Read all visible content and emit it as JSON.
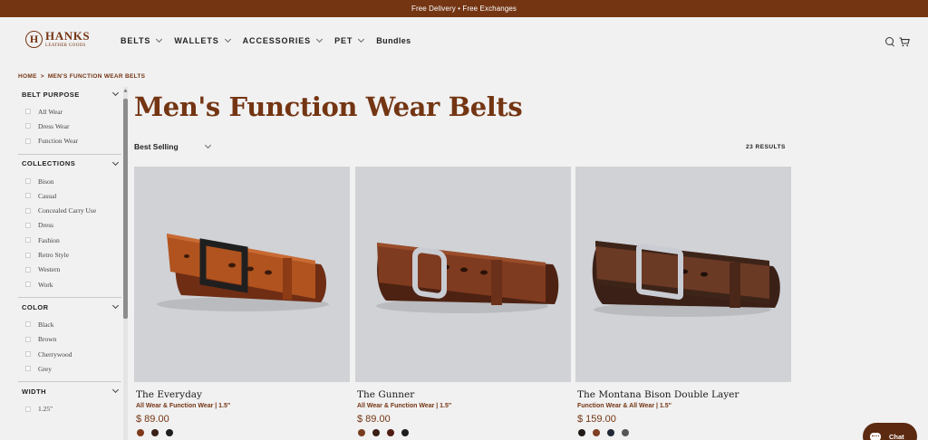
{
  "announcement": "Free Delivery • Free Exchanges",
  "brand": {
    "mark": "H",
    "name": "HANKS",
    "sub": "LEATHER GOODS",
    "color": "#743513"
  },
  "nav": [
    "BELTS",
    "WALLETS",
    "ACCESSORIES",
    "PET",
    "Bundles"
  ],
  "header_icons": [
    "search-icon",
    "cart-icon"
  ],
  "breadcrumb": {
    "home": "HOME",
    "separator": ">",
    "current": "MEN'S FUNCTION WEAR BELTS"
  },
  "filters": [
    {
      "title": "BELT PURPOSE",
      "options": [
        "All Wear",
        "Dress Wear",
        "Function Wear"
      ]
    },
    {
      "title": "COLLECTIONS",
      "options": [
        "Bison",
        "Casual",
        "Concealed Carry Use",
        "Dress",
        "Fashion",
        "Retro Style",
        "Western",
        "Work"
      ]
    },
    {
      "title": "COLOR",
      "options": [
        "Black",
        "Brown",
        "Cherrywood",
        "Grey"
      ]
    },
    {
      "title": "WIDTH",
      "options": [
        "1.25\""
      ]
    }
  ],
  "page_title": "Men's Function Wear Belts",
  "sort_label": "Best Selling",
  "results": "23 RESULTS",
  "products": [
    {
      "name": "The Everyday",
      "subtitle": "All Wear & Function Wear | 1.5\"",
      "price": "$ 89.00",
      "swatches": [
        "#7e3a1c",
        "#3b2118",
        "#1e1e1e"
      ]
    },
    {
      "name": "The Gunner",
      "subtitle": "All Wear & Function Wear | 1.5\"",
      "price": "$ 89.00",
      "swatches": [
        "#7b3d21",
        "#3b1e14",
        "#4f1d13",
        "#1e1e1e"
      ]
    },
    {
      "name": "The Montana Bison Double Layer",
      "subtitle": "Function Wear & All Wear | 1.5\"",
      "price": "$ 159.00",
      "swatches": [
        "#211a17",
        "#7e3e24",
        "#212936",
        "#565656"
      ]
    }
  ],
  "chat_label": "Chat"
}
